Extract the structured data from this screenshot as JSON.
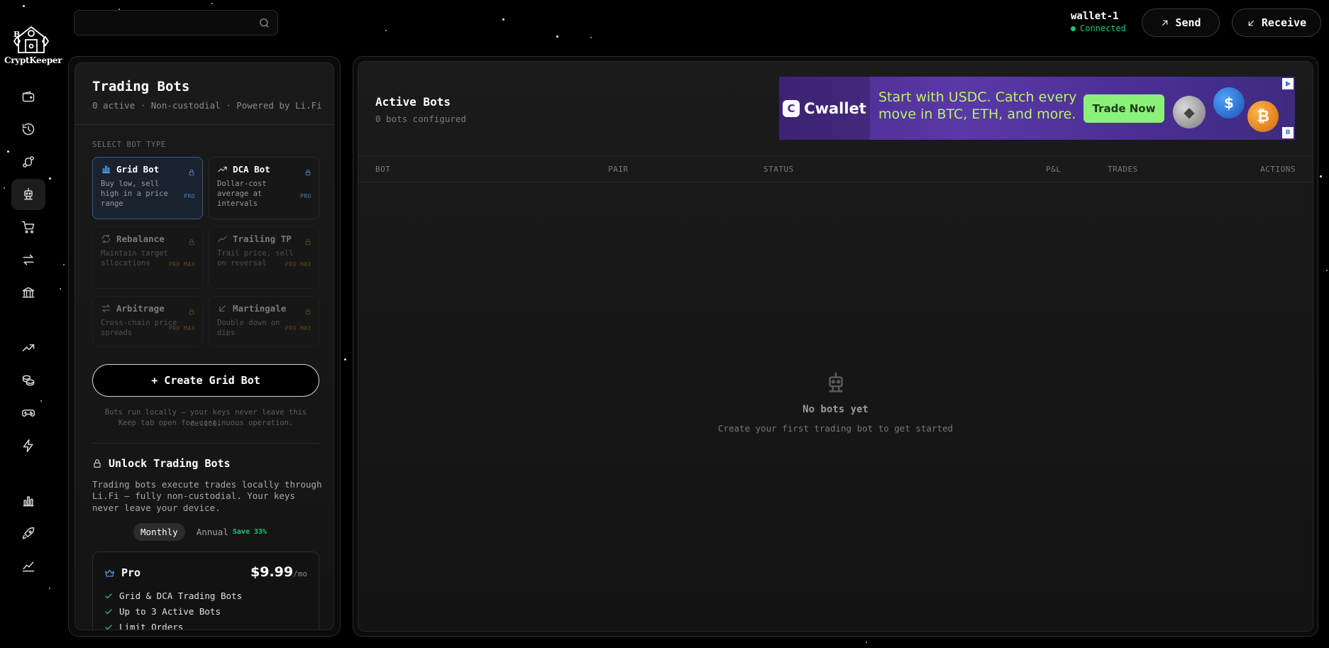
{
  "app": {
    "name": "CryptKeeper"
  },
  "search": {
    "placeholder": ""
  },
  "wallet": {
    "name": "wallet-1",
    "status": "Connected"
  },
  "header": {
    "send_label": "Send",
    "receive_label": "Receive"
  },
  "nav": {
    "items": [
      {
        "icon": "wallet-icon"
      },
      {
        "icon": "history-icon"
      },
      {
        "icon": "bridge-icon"
      },
      {
        "icon": "robot-icon",
        "active": true
      },
      {
        "icon": "cart-icon"
      },
      {
        "icon": "swap-icon"
      },
      {
        "icon": "bank-icon"
      },
      {
        "icon": "trending-up-icon"
      },
      {
        "icon": "coins-icon"
      },
      {
        "icon": "gamepad-icon"
      },
      {
        "icon": "lightning-icon"
      },
      {
        "icon": "bar-chart-icon"
      },
      {
        "icon": "rocket-icon"
      },
      {
        "icon": "line-chart-icon"
      }
    ]
  },
  "left": {
    "title": "Trading Bots",
    "subtitle": "0 active · Non-custodial · Powered by Li.Fi",
    "section_label": "SELECT BOT TYPE",
    "bots": [
      {
        "name": "Grid Bot",
        "desc": "Buy low, sell high in a price range",
        "tier": "PRO",
        "icon": "bar-chart-icon",
        "selected": true
      },
      {
        "name": "DCA Bot",
        "desc": "Dollar-cost average at intervals",
        "tier": "PRO",
        "icon": "trending-up-icon"
      },
      {
        "name": "Rebalance",
        "desc": "Maintain target allocations",
        "tier": "PRO MAX",
        "icon": "refresh-icon"
      },
      {
        "name": "Trailing TP",
        "desc": "Trail price, sell on reversal",
        "tier": "PRO MAX",
        "icon": "chart-line-icon"
      },
      {
        "name": "Arbitrage",
        "desc": "Cross-chain price spreads",
        "tier": "PRO MAX",
        "icon": "arbitrage-icon"
      },
      {
        "name": "Martingale",
        "desc": "Double down on dips",
        "tier": "PRO MAX",
        "icon": "arrow-down-left-icon"
      }
    ],
    "create_label": "+ Create Grid Bot",
    "note_line1": "Bots run locally — your keys never leave this device.",
    "note_line2": "Keep tab open for continuous operation.",
    "unlock_title": "Unlock Trading Bots",
    "unlock_desc": "Trading bots execute trades locally through Li.Fi — fully non-custodial. Your keys never leave your device.",
    "billing": {
      "monthly": "Monthly",
      "annual": "Annual",
      "save": "Save 33%"
    },
    "plan": {
      "name": "Pro",
      "price": "$9.99",
      "period": "/mo",
      "features": [
        "Grid & DCA Trading Bots",
        "Up to 3 Active Bots",
        "Limit Orders"
      ]
    }
  },
  "right": {
    "title": "Active Bots",
    "subtitle": "0 bots configured",
    "columns": [
      "BOT",
      "PAIR",
      "STATUS",
      "P&L",
      "TRADES",
      "ACTIONS"
    ],
    "empty_title": "No bots yet",
    "empty_desc": "Create your first trading bot to get started"
  },
  "ad": {
    "brand": "Cwallet",
    "headline": "Start with USDC. Catch every move in BTC, ETH, and more.",
    "cta": "Trade Now"
  }
}
